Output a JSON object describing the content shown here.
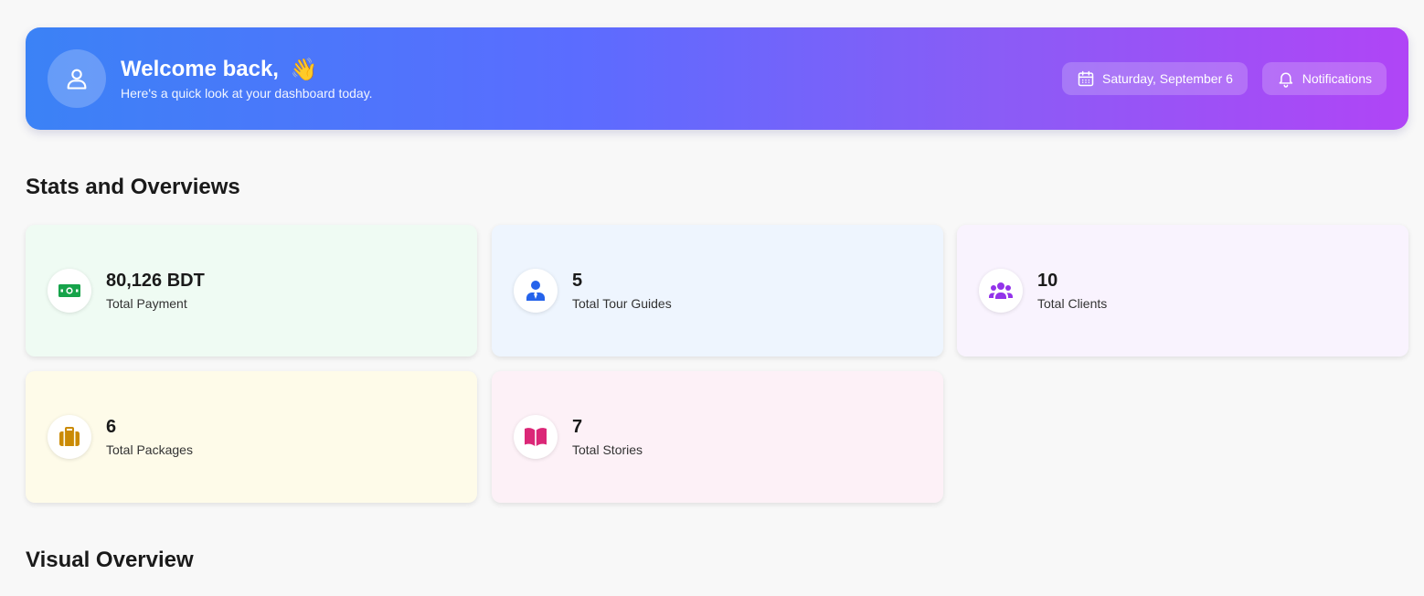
{
  "header": {
    "title": "Welcome back,",
    "wave_emoji": "👋",
    "subtitle": "Here's a quick look at your dashboard today.",
    "date_label": "Saturday, September 6",
    "notifications_label": "Notifications",
    "gradient": [
      "#3b82f6",
      "#b045f6"
    ]
  },
  "stats": {
    "section_title": "Stats and Overviews",
    "cards": [
      {
        "value": "80,126 BDT",
        "label": "Total Payment",
        "icon": "money-icon",
        "bg": "#effbf3",
        "icon_color": "#16a34a"
      },
      {
        "value": "5",
        "label": "Total Tour Guides",
        "icon": "user-tie-icon",
        "bg": "#eef5fe",
        "icon_color": "#2563eb"
      },
      {
        "value": "10",
        "label": "Total Clients",
        "icon": "users-icon",
        "bg": "#f9f3fe",
        "icon_color": "#9333ea"
      },
      {
        "value": "6",
        "label": "Total Packages",
        "icon": "suitcase-icon",
        "bg": "#fefbe9",
        "icon_color": "#ca8a04"
      },
      {
        "value": "7",
        "label": "Total Stories",
        "icon": "book-open-icon",
        "bg": "#fdf1f7",
        "icon_color": "#db2777"
      }
    ]
  },
  "visual": {
    "section_title": "Visual Overview"
  }
}
